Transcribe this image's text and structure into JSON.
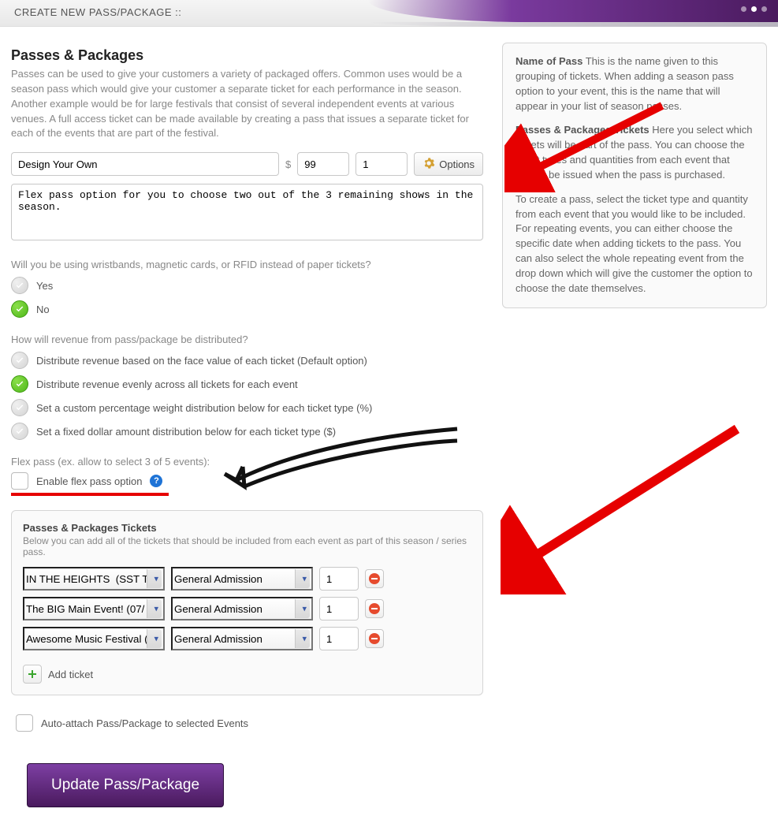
{
  "header": {
    "title": "CREATE NEW PASS/PACKAGE ::"
  },
  "section": {
    "title": "Passes & Packages",
    "intro": "Passes can be used to give your customers a variety of packaged offers. Common uses would be a season pass which would give your customer a separate ticket for each performance in the season. Another example would be for large festivals that consist of several independent events at various venues. A full access ticket can be made available by creating a pass that issues a separate ticket for each of the events that are part of the festival."
  },
  "form": {
    "pass_name": "Design Your Own",
    "currency_symbol": "$",
    "price": "99",
    "quantity": "1",
    "options_label": "Options",
    "description": "Flex pass option for you to choose two out of the 3 remaining shows in the season."
  },
  "wristband": {
    "question": "Will you be using wristbands, magnetic cards, or RFID instead of paper tickets?",
    "yes": "Yes",
    "no": "No"
  },
  "revenue": {
    "question": "How will revenue from pass/package be distributed?",
    "opt_default": "Distribute revenue based on the face value of each ticket (Default option)",
    "opt_even": "Distribute revenue evenly across all tickets for each event",
    "opt_percent": "Set a custom percentage weight distribution below for each ticket type (%)",
    "opt_fixed": "Set a fixed dollar amount distribution below for each ticket type ($)"
  },
  "flexpass": {
    "hint": "Flex pass (ex. allow to select 3 of 5 events):",
    "label": "Enable flex pass option"
  },
  "tickets_panel": {
    "title": "Passes & Packages Tickets",
    "desc": "Below you can add all of the tickets that should be included from each event as part of this season / series pass.",
    "rows": [
      {
        "event": "IN THE HEIGHTS  (SST Te",
        "ticket": "General Admission",
        "qty": "1"
      },
      {
        "event": "The BIG Main Event! (07/",
        "ticket": "General Admission",
        "qty": "1"
      },
      {
        "event": "Awesome Music Festival (",
        "ticket": "General Admission",
        "qty": "1"
      }
    ],
    "add_label": "Add ticket"
  },
  "auto_attach": {
    "label": "Auto-attach Pass/Package to selected Events"
  },
  "submit": {
    "label": "Update Pass/Package"
  },
  "infobox": {
    "p1_bold": "Name of Pass",
    "p1_text": " This is the name given to this grouping of tickets. When adding a season pass option to your event, this is the name that will appear in your list of season passes.",
    "p2_bold": "Passes & Packages Tickets",
    "p2_text": " Here you select which tickets will be part of the pass. You can choose the ticket types and quantities from each event that should be issued when the pass is purchased.",
    "p3_text": "To create a pass, select the ticket type and quantity from each event that you would like to be included. For repeating events, you can either choose the specific date when adding tickets to the pass. You can also select the whole repeating event from the drop down which will give the customer the option to choose the date themselves."
  }
}
